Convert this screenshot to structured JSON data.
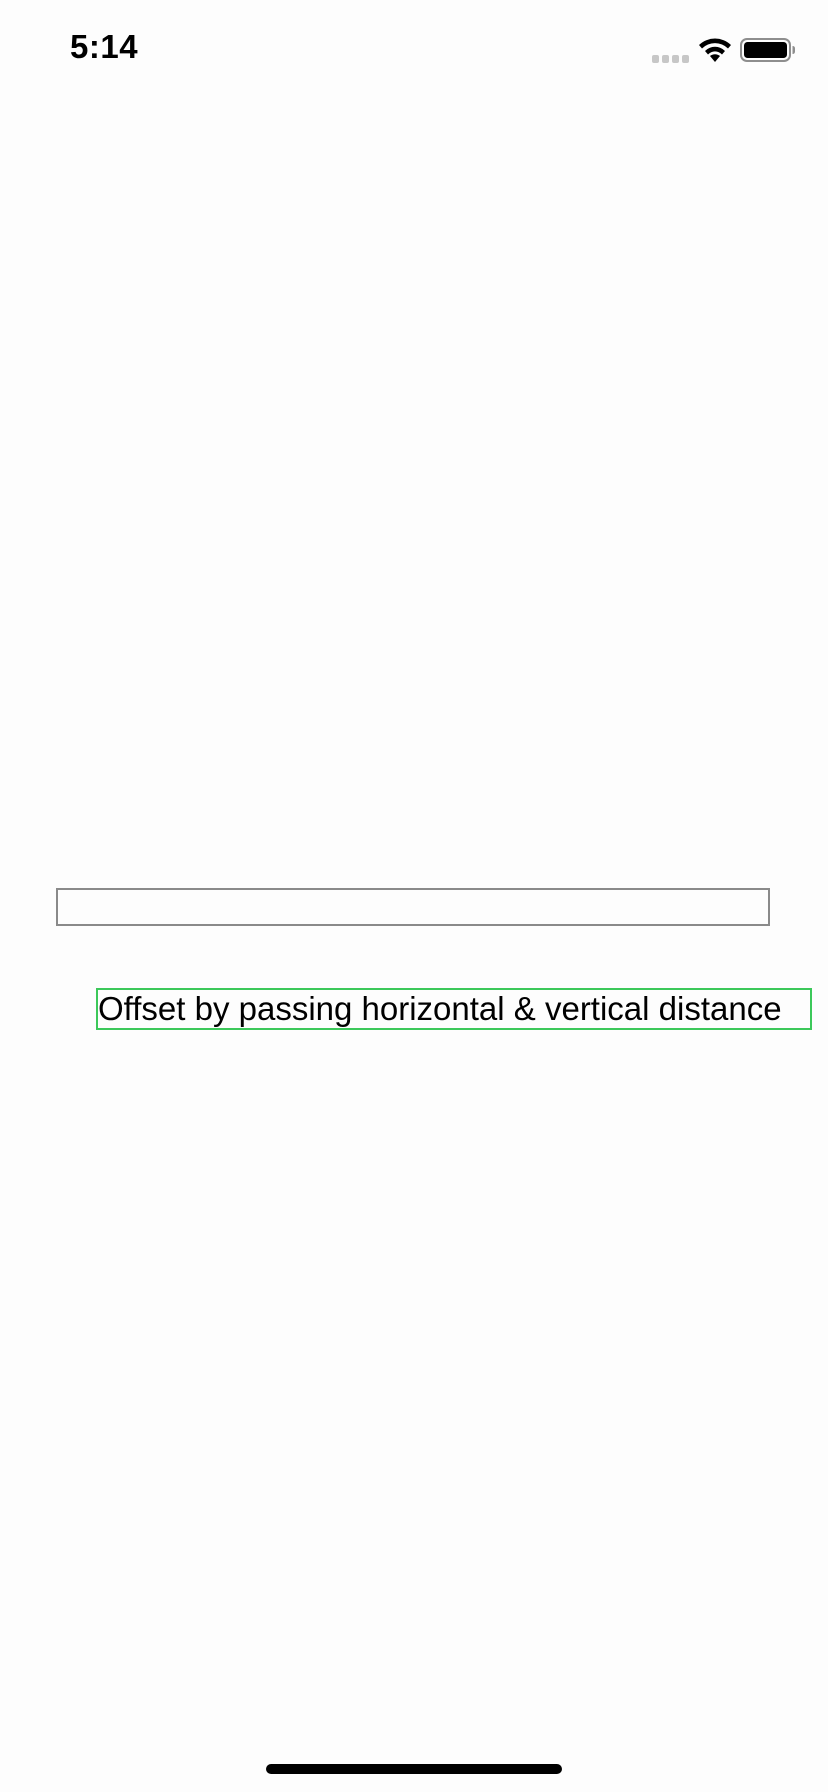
{
  "status_bar": {
    "time": "5:14",
    "signal_icon": "cellular-signal-icon",
    "wifi_icon": "wifi-icon",
    "battery_icon": "battery-icon"
  },
  "main": {
    "offset_label": "Offset by passing horizontal & vertical distance"
  },
  "colors": {
    "box_border": "#8a8a8a",
    "label_border": "#3cc85a",
    "background": "#fdfdfd"
  }
}
